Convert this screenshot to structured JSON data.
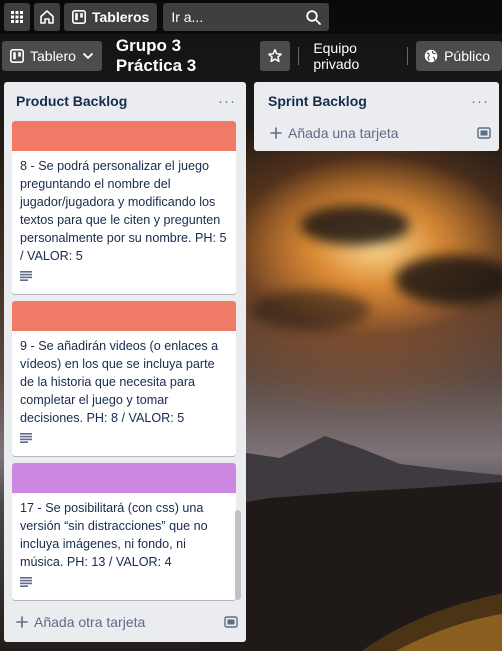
{
  "header": {
    "boards_label": "Tableros",
    "search_placeholder": "Ir a..."
  },
  "board": {
    "view_label": "Tablero",
    "title": "Grupo 3 Práctica 3",
    "team_label": "Equipo privado",
    "visibility_label": "Público"
  },
  "lists": [
    {
      "title": "Product Backlog",
      "cards": [
        {
          "cover": "#f07a66",
          "text": "8 - Se podrá personalizar el juego preguntando el nombre del jugador/jugadora y modificando los textos para que le citen y pregunten personalmente por su nombre. PH: 5 / VALOR: 5"
        },
        {
          "cover": "#f07a66",
          "text": "9 - Se añadirán videos (o enlaces a vídeos) en los que se incluya parte de la historia que necesita para completar el juego y tomar decisiones. PH: 8 / VALOR: 5"
        },
        {
          "cover": "#cc88e0",
          "text": "17 - Se posibilitará (con css) una versión “sin distracciones” que no incluya imágenes, ni fondo, ni música. PH: 13 / VALOR: 4"
        }
      ],
      "add_label": "Añada otra tarjeta"
    },
    {
      "title": "Sprint Backlog",
      "cards": [],
      "add_label": "Añada una tarjeta"
    }
  ],
  "icons": {
    "apps": "apps-grid-icon",
    "home": "home-icon",
    "boards": "boards-icon",
    "search": "search-icon",
    "star": "star-icon",
    "globe": "globe-icon",
    "chevron": "chevron-down-icon",
    "description": "description-icon",
    "template": "template-icon",
    "plus": "plus-icon",
    "more": "more-icon"
  }
}
